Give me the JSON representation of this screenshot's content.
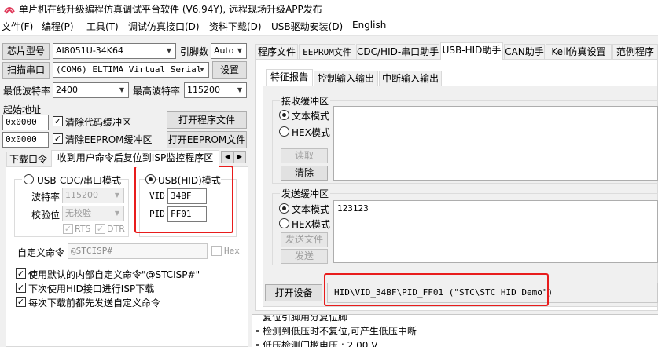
{
  "window": {
    "title": "单片机在线升级编程仿真调试平台软件 (V6.94Y), 远程现场升级APP发布"
  },
  "menu": [
    "文件(F)",
    "编程(P)",
    "工具(T)",
    "调试仿真接口(D)",
    "资料下载(D)",
    "USB驱动安装(D)",
    "English"
  ],
  "left": {
    "chip_label": "芯片型号",
    "chip_value": "AI8051U-34K64",
    "pin_label": "引脚数",
    "pin_value": "Auto",
    "scan_button": "扫描串口",
    "port_value": "(COM6) ELTIMA Virtual Serial P",
    "settings_button": "设置",
    "min_baud_label": "最低波特率",
    "min_baud_value": "2400",
    "max_baud_label": "最高波特率",
    "max_baud_value": "115200",
    "start_addr_label": "起始地址",
    "addr1": "0x0000",
    "clear_code_label": "清除代码缓冲区",
    "open_prog_button": "打开程序文件",
    "addr2": "0x0000",
    "clear_eeprom_label": "清除EEPROM缓冲区",
    "open_eeprom_button": "打开EEPROM文件",
    "tab_download": "下载口令",
    "tab_reset": "收到用户命令后复位到ISP监控程序区",
    "usb_cdc_label": "USB-CDC/串口模式",
    "baud_label": "波特率",
    "baud_value": "115200",
    "parity_label": "校验位",
    "parity_value": "无校验",
    "rts_label": "RTS",
    "dtr_label": "DTR",
    "usb_hid_label": "USB(HID)模式",
    "vid_label": "VID",
    "vid_value": "34BF",
    "pid_label": "PID",
    "pid_value": "FF01",
    "custom_cmd_label": "自定义命令",
    "custom_cmd_value": "@STCISP#",
    "hex_label": "Hex",
    "opt1": "使用默认的内部自定义命令\"@STCISP#\"",
    "opt2": "下次使用HID接口进行ISP下载",
    "opt3": "每次下载前都先发送自定义命令"
  },
  "right": {
    "tabs": [
      "程序文件",
      "EEPROM文件",
      "CDC/HID-串口助手",
      "USB-HID助手",
      "CAN助手",
      "Keil仿真设置",
      "范例程序"
    ],
    "subtabs": [
      "特征报告",
      "控制输入输出",
      "中断输入输出"
    ],
    "recv_title": "接收缓冲区",
    "text_mode": "文本模式",
    "hex_mode": "HEX模式",
    "read_button": "读取",
    "clear_button": "清除",
    "send_title": "发送缓冲区",
    "send_text": "123123",
    "send_file_button": "发送文件",
    "send_button": "发送",
    "open_device_button": "打开设备",
    "device_path": "HID\\VID_34BF\\PID_FF01 (\"STC\\STC HID Demo\")"
  },
  "log": [
    "复位引脚用分复位脚",
    "检测到低压时不复位,可产生低压中断",
    "低压检测门槛电压 : 2.00 V"
  ],
  "colors": {
    "highlight": "#e81c1c",
    "logo": "#e03a5a"
  }
}
